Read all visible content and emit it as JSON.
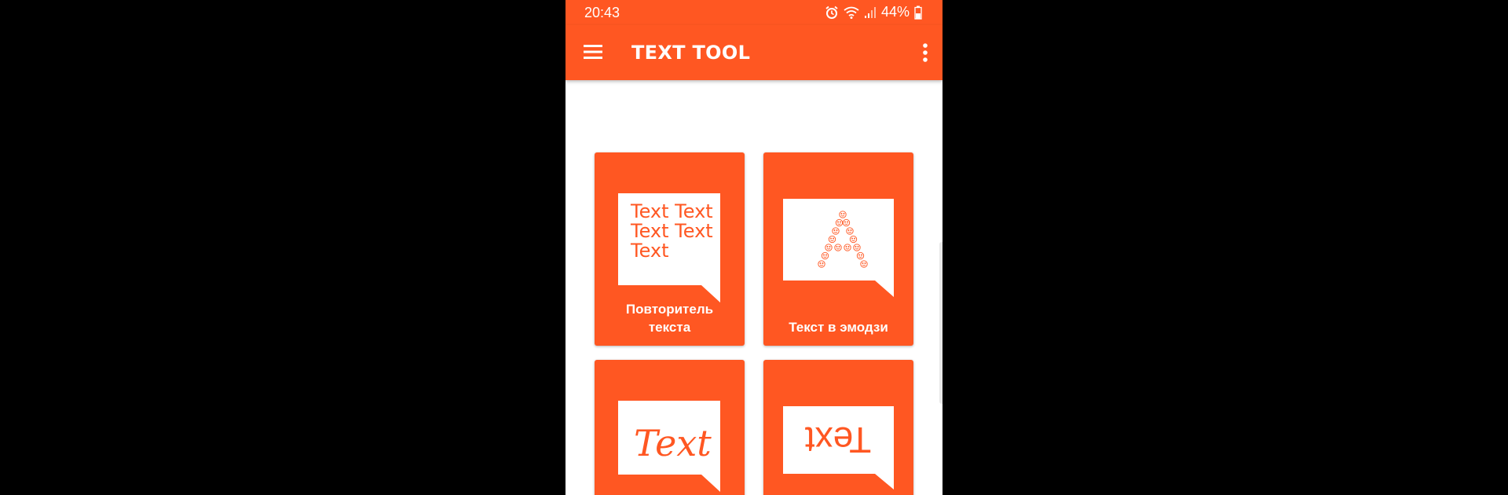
{
  "status_bar": {
    "time": "20:43",
    "battery": "44%",
    "icons": [
      "alarm-icon",
      "wifi-icon",
      "signal-icon",
      "battery-icon"
    ]
  },
  "app_bar": {
    "title": "TEXT TOOL",
    "left_icon": "menu-icon",
    "right_icon": "more-vert-icon"
  },
  "colors": {
    "primary": "#ff5722",
    "background": "#ffffff",
    "text_on_primary": "#ffffff"
  },
  "cards": [
    {
      "label": "Повторитель\nтекста",
      "illustration_lines": [
        "Text Text",
        "Text Text",
        "Text"
      ]
    },
    {
      "label": "Текст в эмодзи",
      "illustration_letter": "A"
    },
    {
      "label": "",
      "illustration_text": "Text"
    },
    {
      "label": "",
      "illustration_text": "Text"
    }
  ]
}
